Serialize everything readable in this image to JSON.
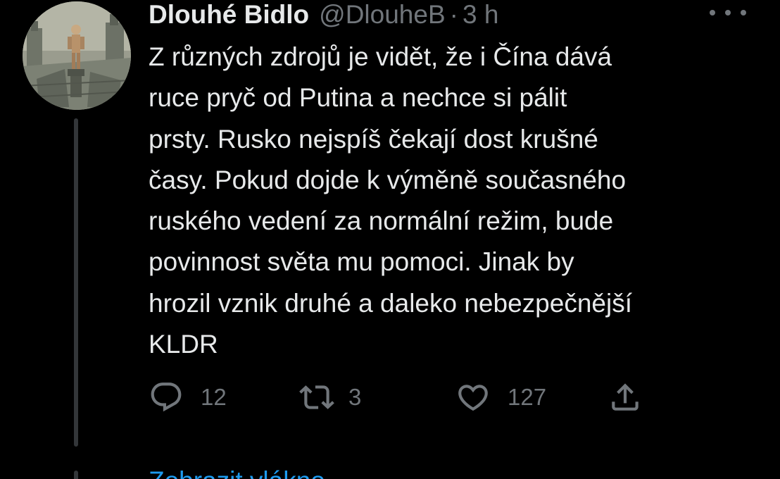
{
  "tweet": {
    "author": {
      "display_name": "Dlouhé Bidlo",
      "handle": "@DlouheB",
      "avatar_icon": "avatar-image"
    },
    "separator": "·",
    "time": "3 h",
    "more_icon": "more-horizontal-icon",
    "text": "Z různých zdrojů je vidět, že i Čína dává\nruce pryč od Putina a nechce si pálit\nprsty. Rusko nejspíš čekají dost krušné\nčasy. Pokud dojde k výměně současného\nruského vedení za normální režim, bude\npovinnost světa mu pomoci. Jinak by\nhrozil vznik druhé a daleko nebezpečnější\nKLDR",
    "actions": {
      "reply": {
        "icon": "reply-icon",
        "count": "12"
      },
      "retweet": {
        "icon": "retweet-icon",
        "count": "3"
      },
      "like": {
        "icon": "heart-icon",
        "count": "127"
      },
      "share": {
        "icon": "share-icon"
      }
    },
    "show_thread_label": "Zobrazit vlákno"
  },
  "colors": {
    "background": "#000000",
    "primary_text": "#e7e9ea",
    "secondary_text": "#71767b",
    "accent": "#1d9bf0",
    "thread_line": "#333639"
  }
}
